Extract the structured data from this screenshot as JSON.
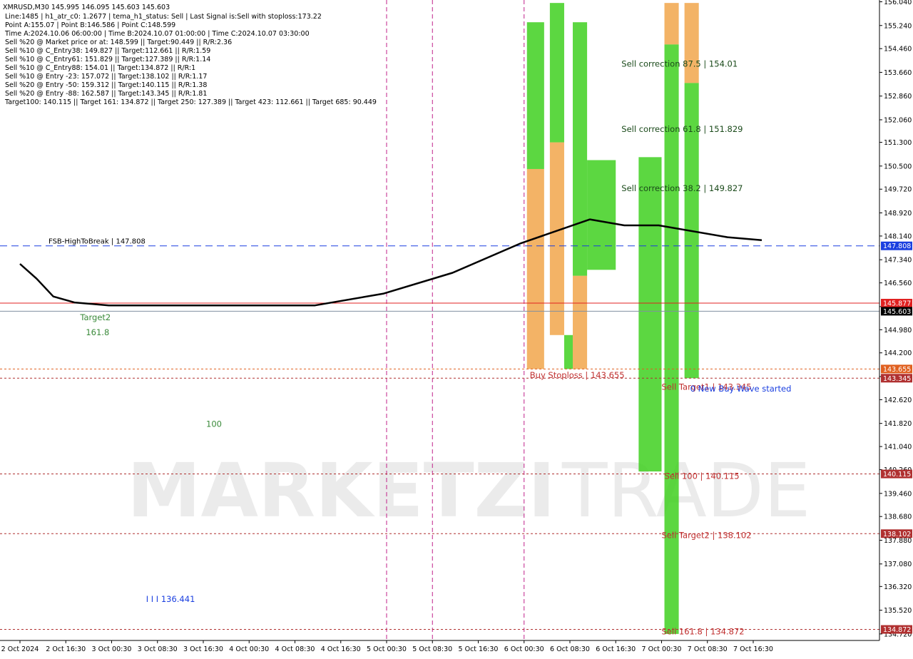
{
  "info_panel": {
    "lines": [
      "XMRUSD,M30  145.995 146.095 145.603 145.603",
      "Line:1485 | h1_atr_c0: 1.2677 | tema_h1_status: Sell | Last Signal is:Sell with stoploss:173.22",
      "Point A:155.07 | Point B:146.586 | Point C:148.599",
      "Time A:2024.10.06 06:00:00 | Time B:2024.10.07 01:00:00 | Time C:2024.10.07 03:30:00",
      "Sell %20 @ Market price or at: 148.599 || Target:90.449 || R/R:2.36",
      "Sell %10 @ C_Entry38: 149.827 || Target:112.661 || R/R:1.59",
      "Sell %10 @ C_Entry61: 151.829 || Target:127.389 || R/R:1.14",
      "Sell %10 @ C_Entry88: 154.01 || Target:134.872 || R/R:1",
      "Sell %10 @ Entry -23: 157.072 || Target:138.102 || R/R:1.17",
      "Sell %20 @ Entry -50: 159.312 || Target:140.115 || R/R:1.38",
      "Sell %20 @ Entry -88: 162.587 || Target:143.345 || R/R:1.81",
      "Target100: 140.115 || Target 161: 134.872 || Target 250: 127.389 || Target 423: 112.661 || Target 685: 90.449"
    ]
  },
  "watermark": {
    "left": "MARKETZI",
    "right": "TRADE"
  },
  "chart_data": {
    "type": "candlestick",
    "symbol": "XMRUSD",
    "timeframe": "M30",
    "ohlc_last": {
      "open": 145.995,
      "high": 146.095,
      "low": 145.603,
      "close": 145.603
    },
    "ylim": [
      134.5,
      156.1
    ],
    "y_ticks": [
      "156.040",
      "155.240",
      "154.460",
      "153.660",
      "152.860",
      "152.060",
      "151.300",
      "150.500",
      "149.720",
      "148.920",
      "148.140",
      "147.340",
      "146.560",
      "145.760",
      "144.980",
      "144.200",
      "143.400",
      "142.620",
      "141.820",
      "141.040",
      "140.260",
      "139.460",
      "138.680",
      "137.880",
      "137.080",
      "136.320",
      "135.520",
      "134.720"
    ],
    "x_ticks": [
      "2 Oct 2024",
      "2 Oct 16:30",
      "3 Oct 00:30",
      "3 Oct 08:30",
      "3 Oct 16:30",
      "4 Oct 00:30",
      "4 Oct 08:30",
      "4 Oct 16:30",
      "5 Oct 00:30",
      "5 Oct 08:30",
      "5 Oct 16:30",
      "6 Oct 00:30",
      "6 Oct 08:30",
      "6 Oct 16:30",
      "7 Oct 00:30",
      "7 Oct 08:30",
      "7 Oct 16:30"
    ],
    "price_badges": [
      {
        "value": 147.808,
        "label": "147.808",
        "color": "#1a3fe0"
      },
      {
        "value": 145.877,
        "label": "145.877",
        "color": "#e02020"
      },
      {
        "value": 145.603,
        "label": "145.603",
        "color": "#000000"
      },
      {
        "value": 143.655,
        "label": "143.655",
        "color": "#e06020"
      },
      {
        "value": 143.345,
        "label": "143.345",
        "color": "#b03030"
      },
      {
        "value": 140.115,
        "label": "140.115",
        "color": "#b03030"
      },
      {
        "value": 138.102,
        "label": "138.102",
        "color": "#b03030"
      },
      {
        "value": 134.872,
        "label": "134.872",
        "color": "#b03030"
      }
    ],
    "hlines": [
      {
        "value": 147.808,
        "color": "#1a3fe0",
        "dash": "10,6",
        "label": "FSB-HighToBreak | 147.808"
      },
      {
        "value": 145.877,
        "color": "#e02020",
        "dash": "",
        "label": ""
      },
      {
        "value": 145.603,
        "color": "#8090a0",
        "dash": "",
        "label": ""
      },
      {
        "value": 143.655,
        "color": "#e06020",
        "dash": "3,3",
        "label": ""
      },
      {
        "value": 143.345,
        "color": "#b03030",
        "dash": "3,3",
        "label": ""
      },
      {
        "value": 140.115,
        "color": "#b03030",
        "dash": "3,3",
        "label": ""
      },
      {
        "value": 138.102,
        "color": "#b03030",
        "dash": "3,3",
        "label": ""
      },
      {
        "value": 134.872,
        "color": "#b03030",
        "dash": "3,3",
        "label": ""
      }
    ],
    "vlines": [
      {
        "x_label": "5 Oct 00:30",
        "color": "#c0208a"
      },
      {
        "x_label": "5 Oct 08:30",
        "color": "#c0208a"
      },
      {
        "x_label": "6 Oct 00:30",
        "color": "#c0208a"
      }
    ],
    "annotations": [
      {
        "text": "Target2",
        "price": 145.3,
        "time": "2 Oct 2024 19:00",
        "color": "#3a8a3a"
      },
      {
        "text": "161.8",
        "price": 144.8,
        "time": "2 Oct 2024 20:00",
        "color": "#3a8a3a"
      },
      {
        "text": "100",
        "price": 141.7,
        "time": "3 Oct 2024 17:00",
        "color": "#3a8a3a"
      },
      {
        "text": "I I I 136.441",
        "price": 135.8,
        "time": "3 Oct 2024 06:30",
        "color": "#1a3fe0"
      },
      {
        "text": "Buy Stoploss | 143.655",
        "price": 143.35,
        "time": "6 Oct 2024 01:30",
        "color": "#c03030"
      },
      {
        "text": "Sell correction 87.5 | 154.01",
        "price": 153.85,
        "time": "6 Oct 2024 17:30",
        "color": "#1a4a1a"
      },
      {
        "text": "Sell correction 61.8 | 151.829",
        "price": 151.65,
        "time": "6 Oct 2024 17:30",
        "color": "#1a4a1a"
      },
      {
        "text": "Sell correction 38.2 | 149.827",
        "price": 149.65,
        "time": "6 Oct 2024 17:30",
        "color": "#1a4a1a"
      },
      {
        "text": "Sell Target1 | 143.345",
        "price": 142.95,
        "time": "7 Oct 2024 00:30",
        "color": "#c03030"
      },
      {
        "text": "0 New Buy Wave started",
        "price": 142.9,
        "time": "7 Oct 2024 05:30",
        "color": "#1a3fe0"
      },
      {
        "text": "Sell 100 | 140.115",
        "price": 139.95,
        "time": "7 Oct 2024 01:00",
        "color": "#c03030"
      },
      {
        "text": "Sell Target2 | 138.102",
        "price": 137.95,
        "time": "7 Oct 2024 00:30",
        "color": "#c03030"
      },
      {
        "text": "Sell 161.8 | 134.872",
        "price": 134.7,
        "time": "7 Oct 2024 00:30",
        "color": "#c03030"
      }
    ],
    "zones": [
      {
        "color": "#f0a040",
        "alpha": 0.8,
        "t0": "6 Oct 2024 01:00",
        "t1": "6 Oct 2024 04:00",
        "y0": 143.655,
        "y1": 150.4
      },
      {
        "color": "#40d020",
        "alpha": 0.85,
        "t0": "6 Oct 2024 01:00",
        "t1": "6 Oct 2024 04:00",
        "y0": 150.4,
        "y1": 155.35
      },
      {
        "color": "#f0a040",
        "alpha": 0.8,
        "t0": "6 Oct 2024 05:00",
        "t1": "6 Oct 2024 07:30",
        "y0": 144.8,
        "y1": 151.3
      },
      {
        "color": "#40d020",
        "alpha": 0.85,
        "t0": "6 Oct 2024 05:00",
        "t1": "6 Oct 2024 07:30",
        "y0": 151.3,
        "y1": 156.0
      },
      {
        "color": "#40d020",
        "alpha": 0.85,
        "t0": "6 Oct 2024 07:30",
        "t1": "6 Oct 2024 09:00",
        "y0": 143.655,
        "y1": 144.8
      },
      {
        "color": "#f0a040",
        "alpha": 0.8,
        "t0": "6 Oct 2024 09:00",
        "t1": "6 Oct 2024 11:30",
        "y0": 143.655,
        "y1": 146.8
      },
      {
        "color": "#40d020",
        "alpha": 0.85,
        "t0": "6 Oct 2024 09:00",
        "t1": "6 Oct 2024 11:30",
        "y0": 146.8,
        "y1": 155.35
      },
      {
        "color": "#40d020",
        "alpha": 0.85,
        "t0": "6 Oct 2024 11:30",
        "t1": "6 Oct 2024 16:30",
        "y0": 147.0,
        "y1": 150.7
      },
      {
        "color": "#40d020",
        "alpha": 0.85,
        "t0": "6 Oct 2024 20:30",
        "t1": "7 Oct 2024 00:30",
        "y0": 140.2,
        "y1": 150.8
      },
      {
        "color": "#f0a040",
        "alpha": 0.8,
        "t0": "7 Oct 2024 01:00",
        "t1": "7 Oct 2024 03:30",
        "y0": 154.6,
        "y1": 156.0
      },
      {
        "color": "#40d020",
        "alpha": 0.85,
        "t0": "7 Oct 2024 01:00",
        "t1": "7 Oct 2024 03:30",
        "y0": 134.72,
        "y1": 154.6
      },
      {
        "color": "#f0a040",
        "alpha": 0.8,
        "t0": "7 Oct 2024 04:30",
        "t1": "7 Oct 2024 07:00",
        "y0": 153.3,
        "y1": 156.0
      },
      {
        "color": "#40d020",
        "alpha": 0.85,
        "t0": "7 Oct 2024 04:30",
        "t1": "7 Oct 2024 07:00",
        "y0": 143.345,
        "y1": 153.3
      }
    ],
    "series": [
      {
        "name": "",
        "kind": "ma",
        "color": "#000000",
        "width": 2.5,
        "points": [
          [
            "2 Oct 2024 00:00",
            147.2
          ],
          [
            "2 Oct 2024 06:00",
            146.7
          ],
          [
            "2 Oct 2024 12:00",
            146.1
          ],
          [
            "2 Oct 2024 18:00",
            145.9
          ],
          [
            "3 Oct 2024 00:00",
            145.8
          ],
          [
            "3 Oct 2024 12:00",
            145.8
          ],
          [
            "4 Oct 2024 00:00",
            145.8
          ],
          [
            "4 Oct 2024 12:00",
            145.8
          ],
          [
            "5 Oct 2024 00:00",
            146.2
          ],
          [
            "5 Oct 2024 12:00",
            146.9
          ],
          [
            "6 Oct 2024 00:00",
            147.9
          ],
          [
            "6 Oct 2024 12:00",
            148.7
          ],
          [
            "6 Oct 2024 18:00",
            148.5
          ],
          [
            "7 Oct 2024 00:00",
            148.5
          ],
          [
            "7 Oct 2024 12:00",
            148.1
          ],
          [
            "7 Oct 2024 18:00",
            148.0
          ]
        ]
      }
    ],
    "grid": false,
    "legend": "none",
    "colors": {
      "background": "#ffffff",
      "candle_up": "#000000",
      "candle_down": "#000000",
      "fast_ma": "#1a1a8a",
      "mid_ma": "#30c030",
      "slow_ma": "#000000",
      "donchian": "#ff4000",
      "buy_arrow": "#1a3fe0",
      "sell_arrow": "#e02020",
      "orange_zone": "#f0a040",
      "green_zone": "#40d020"
    }
  }
}
